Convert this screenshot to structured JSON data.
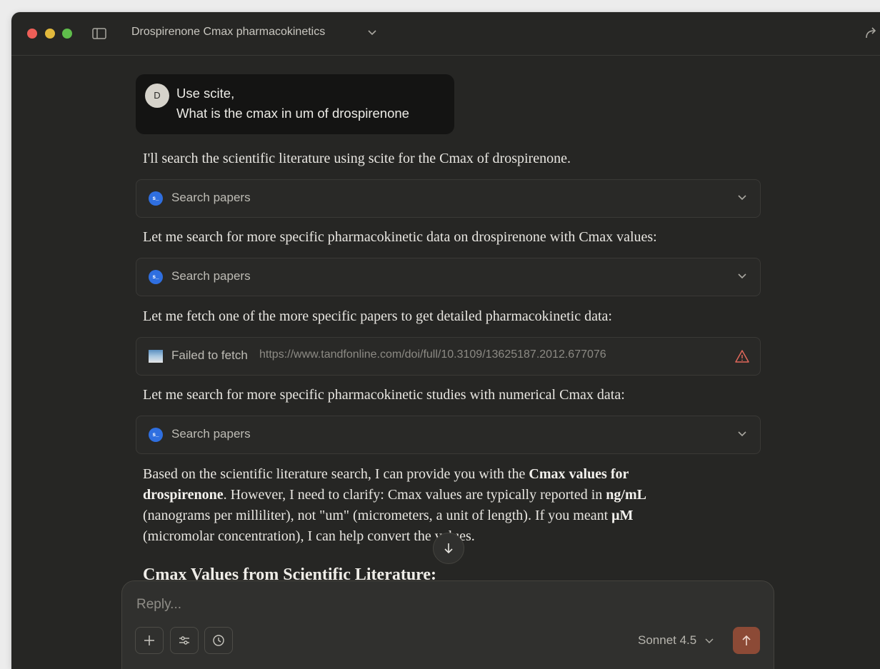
{
  "header": {
    "conversation_title": "Drospirenone Cmax pharmacokinetics"
  },
  "user_message": {
    "avatar_initial": "D",
    "line1": "Use scite,",
    "line2": "What is the cmax in um of drospirenone"
  },
  "messages": {
    "m1": "I'll search the scientific literature using scite for the Cmax of drospirenone.",
    "m2": "Let me search for more specific pharmacokinetic data on drospirenone with Cmax values:",
    "m3": "Let me fetch one of the more specific papers to get detailed pharmacokinetic data:",
    "m4": "Let me search for more specific pharmacokinetic studies with numerical Cmax data:"
  },
  "tools": {
    "search1": {
      "icon": "scite-icon",
      "icon_text": "s_",
      "label": "Search papers"
    },
    "search2": {
      "icon": "scite-icon",
      "icon_text": "s_",
      "label": "Search papers"
    },
    "fetch": {
      "icon": "web-image-icon",
      "label": "Failed to fetch",
      "url": "https://www.tandfonline.com/doi/full/10.3109/13625187.2012.677076"
    },
    "search3": {
      "icon": "scite-icon",
      "icon_text": "s_",
      "label": "Search papers"
    }
  },
  "final_answer": {
    "p1": "Based on the scientific literature search, I can provide you with the ",
    "b1": "Cmax values for drospirenone",
    "p2": ". However, I need to clarify: Cmax values are typically reported in ",
    "b2": "ng/mL",
    "p3": " (nanograms per milliliter), not \"um\" (micrometers, a unit of length). If you meant ",
    "b3": "μM",
    "p4": " (micromolar concentration), I can help convert the values.",
    "heading": "Cmax Values from Scientific Literature:"
  },
  "composer": {
    "placeholder": "Reply...",
    "model": "Sonnet 4.5"
  },
  "colors": {
    "background": "#262624",
    "send_button": "#8c4a36",
    "scite_blue": "#2f6fe0",
    "warning_red": "#e0675a"
  }
}
